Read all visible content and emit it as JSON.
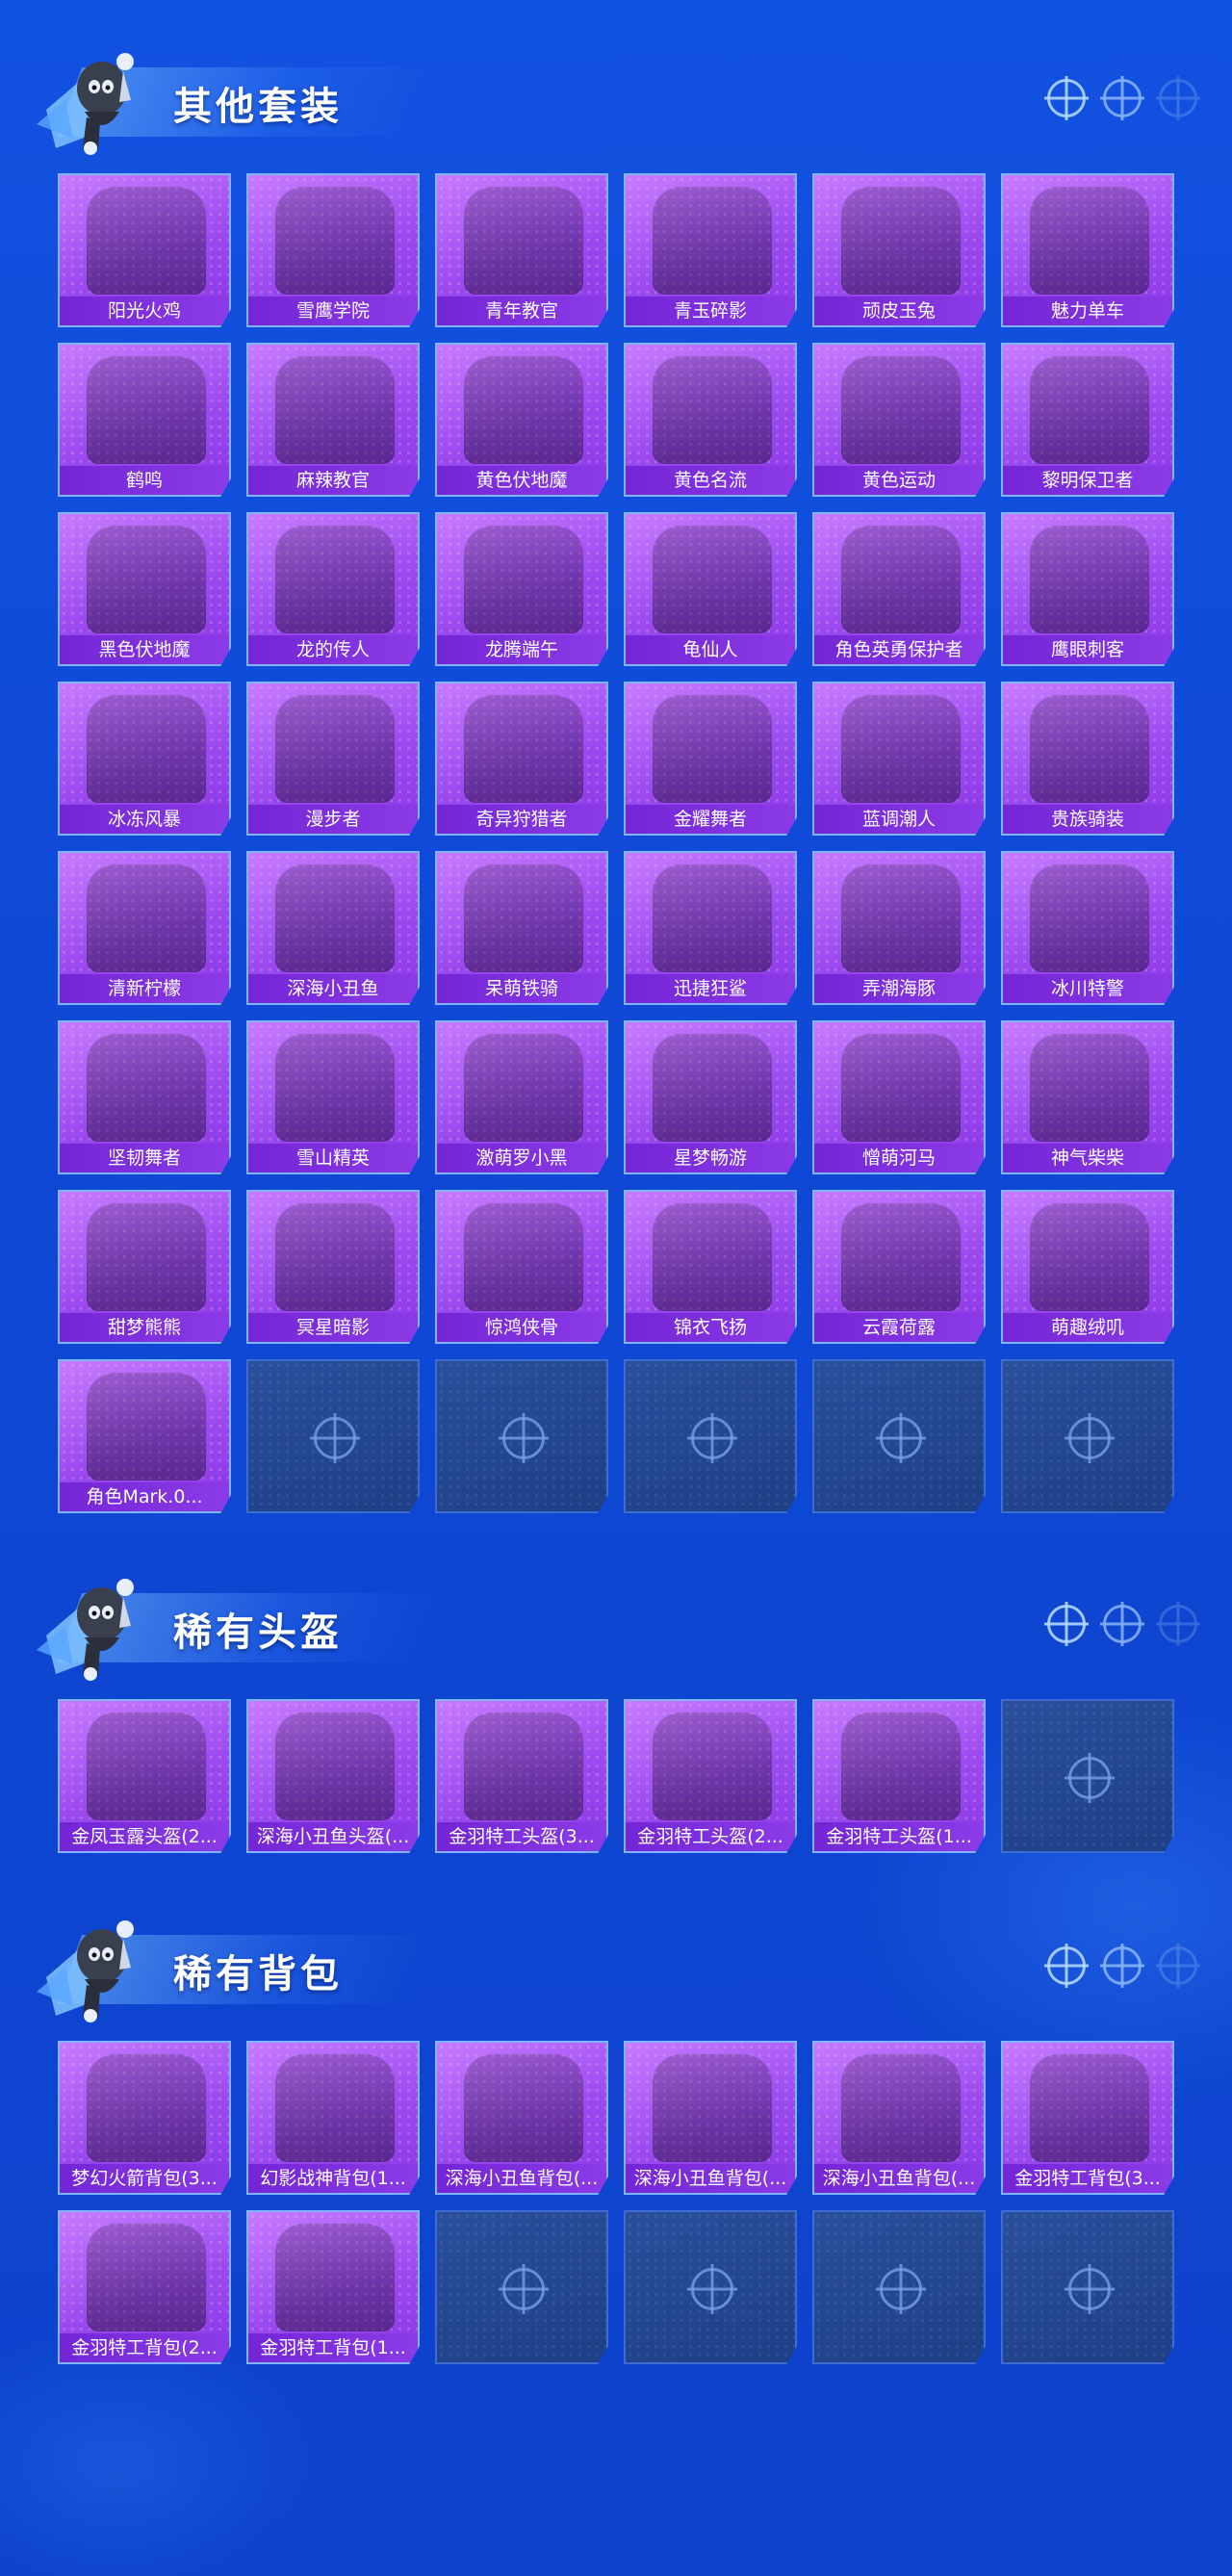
{
  "sections": [
    {
      "title": "其他套装",
      "icon": "mascot-icon",
      "items": [
        "阳光火鸡",
        "雪鹰学院",
        "青年教官",
        "青玉碎影",
        "顽皮玉兔",
        "魅力单车",
        "鹤鸣",
        "麻辣教官",
        "黄色伏地魔",
        "黄色名流",
        "黄色运动",
        "黎明保卫者",
        "黑色伏地魔",
        "龙的传人",
        "龙腾端午",
        "龟仙人",
        "角色英勇保护者",
        "鹰眼刺客",
        "冰冻风暴",
        "漫步者",
        "奇异狩猎者",
        "金耀舞者",
        "蓝调潮人",
        "贵族骑装",
        "清新柠檬",
        "深海小丑鱼",
        "呆萌铁骑",
        "迅捷狂鲨",
        "弄潮海豚",
        "冰川特警",
        "坚韧舞者",
        "雪山精英",
        "激萌罗小黑",
        "星梦畅游",
        "憎萌河马",
        "神气柴柴",
        "甜梦熊熊",
        "冥星暗影",
        "惊鸿侠骨",
        "锦衣飞扬",
        "云霞荷露",
        "萌趣绒叽",
        "角色Mark.0..."
      ],
      "empty_slots": 5
    },
    {
      "title": "稀有头盔",
      "icon": "mascot-icon",
      "items": [
        "金凤玉露头盔(2...",
        "深海小丑鱼头盔(...",
        "金羽特工头盔(3...",
        "金羽特工头盔(2...",
        "金羽特工头盔(1..."
      ],
      "empty_slots": 1
    },
    {
      "title": "稀有背包",
      "icon": "mascot-icon",
      "items": [
        "梦幻火箭背包(3...",
        "幻影战神背包(1...",
        "深海小丑鱼背包(...",
        "深海小丑鱼背包(...",
        "深海小丑鱼背包(...",
        "金羽特工背包(3...",
        "金羽特工背包(2...",
        "金羽特工背包(1..."
      ],
      "empty_slots": 4
    }
  ],
  "colors": {
    "background": "#1252e0",
    "card": "#9b4aef",
    "label": "#7425d6",
    "empty_card": "#2a4f9c"
  },
  "decor_icons": [
    "crosshair-icon",
    "crosshair-icon",
    "crosshair-icon"
  ]
}
